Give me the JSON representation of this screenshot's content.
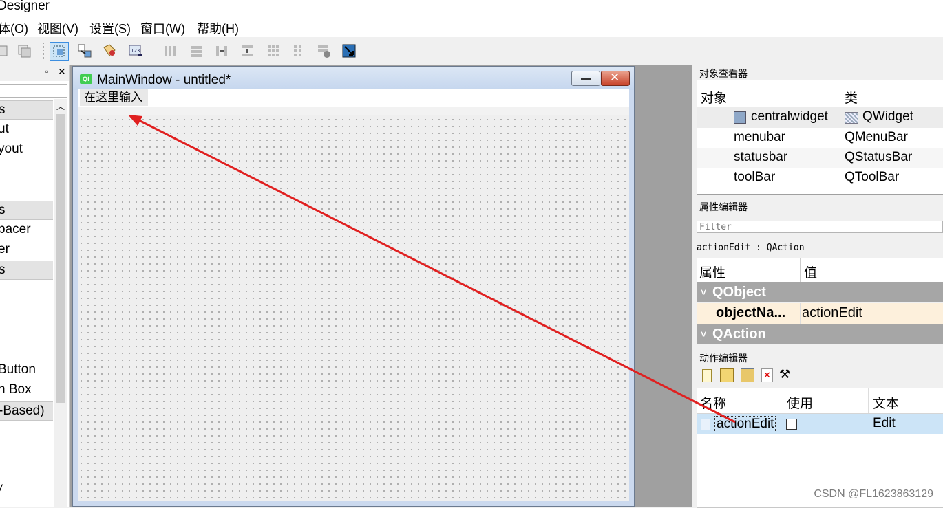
{
  "window": {
    "title": "Designer"
  },
  "menu": [
    "体(O)",
    "视图(V)",
    "设置(S)",
    "窗口(W)",
    "帮助(H)"
  ],
  "toolbar": {
    "icons": [
      "copy-icon",
      "paste-icon",
      "edit-widgets-icon",
      "edit-signals-slots-icon",
      "edit-buddies-icon",
      "edit-tab-order-icon",
      "layout-horizontal-icon",
      "layout-vertical-icon",
      "layout-splitter-h-icon",
      "layout-splitter-v-icon",
      "layout-grid-icon",
      "layout-form-icon",
      "break-layout-icon",
      "adjust-size-icon"
    ]
  },
  "widget_box": {
    "categories": [
      "s",
      "s",
      "s",
      "-Based)"
    ],
    "items": [
      "ut",
      "yout",
      "pacer",
      "er",
      "Button",
      "n Box",
      "y"
    ]
  },
  "form": {
    "title": "MainWindow - untitled*",
    "qt_logo": "Qt",
    "type_here": "在这里输入"
  },
  "object_inspector": {
    "title": "对象查看器",
    "headers": [
      "对象",
      "类"
    ],
    "rows": [
      {
        "object": "centralwidget",
        "class": "QWidget"
      },
      {
        "object": "menubar",
        "class": "QMenuBar"
      },
      {
        "object": "statusbar",
        "class": "QStatusBar"
      },
      {
        "object": "toolBar",
        "class": "QToolBar"
      }
    ]
  },
  "property_editor": {
    "title": "属性编辑器",
    "filter_placeholder": "Filter",
    "object_label": "actionEdit : QAction",
    "headers": [
      "属性",
      "值"
    ],
    "group1": "QObject",
    "prop_name": "objectNa...",
    "prop_value": "actionEdit",
    "group2": "QAction"
  },
  "action_editor": {
    "title": "动作编辑器",
    "headers": [
      "名称",
      "使用",
      "文本"
    ],
    "row": {
      "name": "actionEdit",
      "text": "Edit"
    }
  },
  "watermark": "CSDN @FL1623863129",
  "colors": {
    "arrow": "#e02020",
    "selection": "#cce4f7",
    "group_header": "#a6a6a6",
    "prop_row": "#fdf0dc"
  }
}
